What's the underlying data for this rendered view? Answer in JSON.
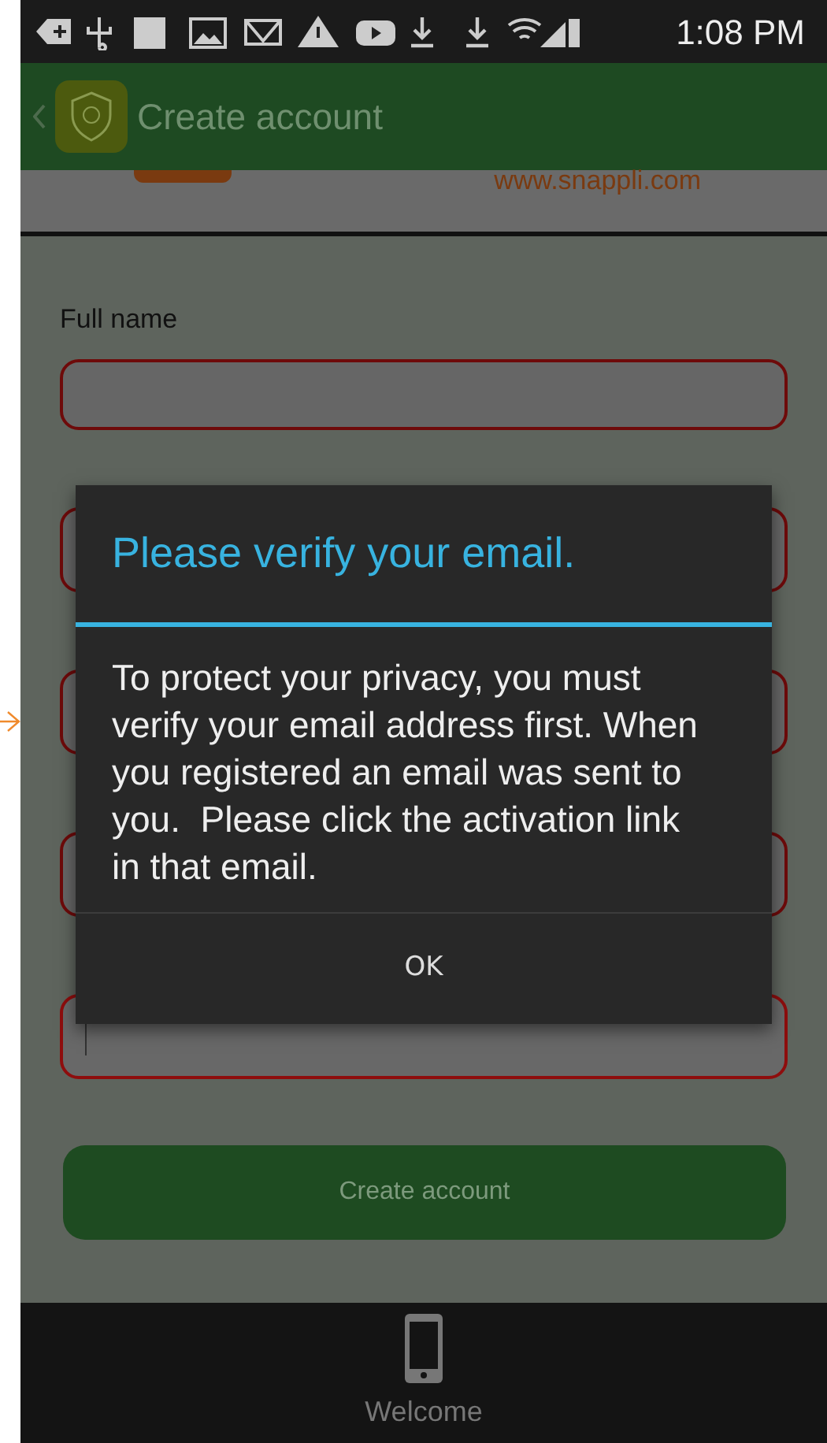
{
  "status_bar": {
    "time": "1:08 PM"
  },
  "app_bar": {
    "title": "Create account"
  },
  "header": {
    "website": "www.snappli.com"
  },
  "form": {
    "fields": [
      {
        "label": "Full name",
        "focused": false
      },
      {
        "focused": false
      },
      {
        "focused": false
      },
      {
        "focused": false
      },
      {
        "focused": true
      }
    ],
    "submit": "Create account"
  },
  "dialog": {
    "title": "Please verify your email.",
    "message": "To protect your privacy, you must verify your email address first. When you registered an email was sent to you.  Please click the activation link in that email.",
    "button": "OK"
  },
  "bottom_nav": [
    {
      "label": "Welcome"
    }
  ]
}
